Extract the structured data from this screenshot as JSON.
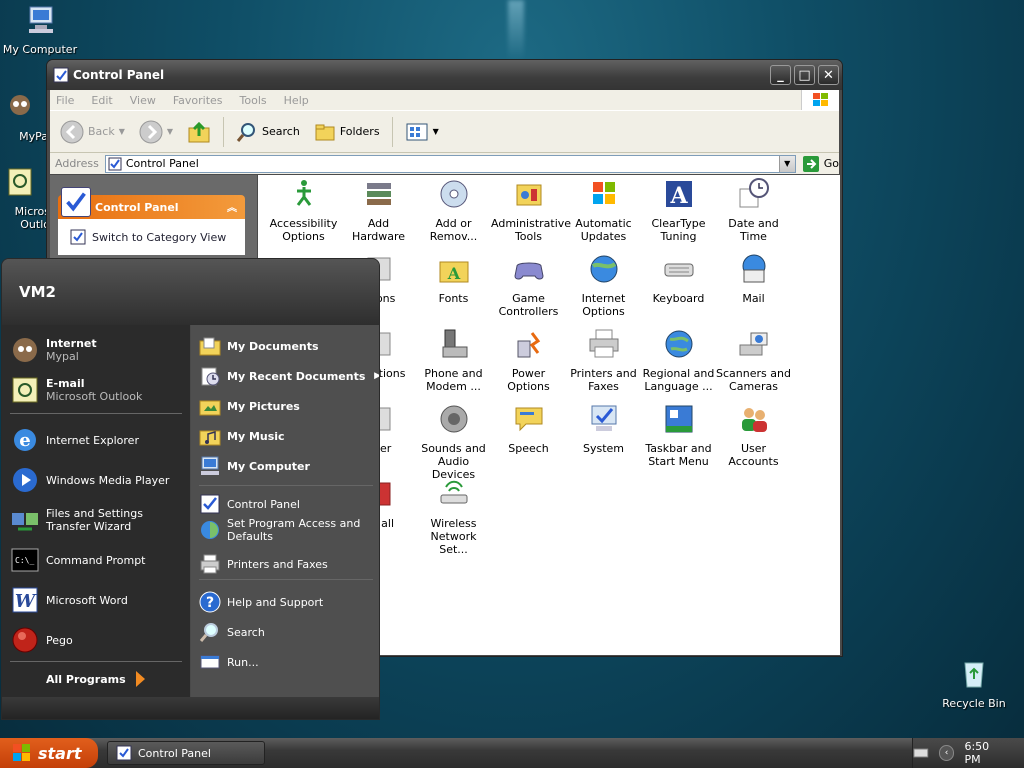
{
  "desktop": {
    "icons": [
      {
        "label": "My Computer"
      },
      {
        "label": "MyPa"
      },
      {
        "label": "Micros Outlo"
      },
      {
        "label": "Recycle Bin"
      }
    ]
  },
  "window": {
    "title": "Control Panel",
    "menu": [
      "File",
      "Edit",
      "View",
      "Favorites",
      "Tools",
      "Help"
    ],
    "toolbar": {
      "back": "Back",
      "search": "Search",
      "folders": "Folders"
    },
    "address": {
      "label": "Address",
      "value": "Control Panel",
      "go": "Go"
    },
    "taskpane": {
      "header": "Control Panel",
      "link": "Switch to Category View"
    },
    "items": [
      {
        "label": "Accessibility Options",
        "icon": "accessibility-icon"
      },
      {
        "label": "Add Hardware",
        "icon": "hardware-icon"
      },
      {
        "label": "Add or Remov...",
        "icon": "add-remove-icon"
      },
      {
        "label": "Administrative Tools",
        "icon": "admin-tools-icon"
      },
      {
        "label": "Automatic Updates",
        "icon": "updates-icon"
      },
      {
        "label": "ClearType Tuning",
        "icon": "cleartype-icon"
      },
      {
        "label": "Date and Time",
        "icon": "clock-icon"
      },
      {
        "label": "ptions",
        "icon": "options-icon"
      },
      {
        "label": "Fonts",
        "icon": "fonts-icon"
      },
      {
        "label": "Game Controllers",
        "icon": "gamepad-icon"
      },
      {
        "label": "Internet Options",
        "icon": "globe-icon"
      },
      {
        "label": "Keyboard",
        "icon": "keyboard-icon"
      },
      {
        "label": "Mail",
        "icon": "mail-icon"
      },
      {
        "label": "ork ctions",
        "icon": "network-icon"
      },
      {
        "label": "Phone and Modem ...",
        "icon": "phone-icon"
      },
      {
        "label": "Power Options",
        "icon": "power-icon"
      },
      {
        "label": "Printers and Faxes",
        "icon": "printer-icon"
      },
      {
        "label": "Regional and Language ...",
        "icon": "regional-icon"
      },
      {
        "label": "Scanners and Cameras",
        "icon": "scanner-icon"
      },
      {
        "label": "ty er",
        "icon": "security-icon"
      },
      {
        "label": "Sounds and Audio Devices",
        "icon": "speaker-icon"
      },
      {
        "label": "Speech",
        "icon": "speech-icon"
      },
      {
        "label": "System",
        "icon": "system-icon"
      },
      {
        "label": "Taskbar and Start Menu",
        "icon": "taskbar-icon"
      },
      {
        "label": "User Accounts",
        "icon": "users-icon"
      },
      {
        "label": "ws all",
        "icon": "firewall-icon"
      },
      {
        "label": "Wireless Network Set...",
        "icon": "wireless-icon"
      }
    ]
  },
  "startmenu": {
    "user": "VM2",
    "pinned": [
      {
        "title": "Internet",
        "sub": "Mypal"
      },
      {
        "title": "E-mail",
        "sub": "Microsoft Outlook"
      }
    ],
    "recent": [
      "Internet Explorer",
      "Windows Media Player",
      "Files and Settings Transfer Wizard",
      "Command Prompt",
      "Microsoft Word",
      "Pego"
    ],
    "all_programs": "All Programs",
    "right_bold": [
      "My Documents",
      "My Recent Documents",
      "My Pictures",
      "My Music",
      "My Computer"
    ],
    "right_mid": [
      "Control Panel",
      "Set Program Access and Defaults",
      "Printers and Faxes"
    ],
    "right_bottom": [
      "Help and Support",
      "Search",
      "Run..."
    ]
  },
  "taskbar": {
    "start": "start",
    "task": "Control Panel",
    "clock": "6:50 PM"
  }
}
